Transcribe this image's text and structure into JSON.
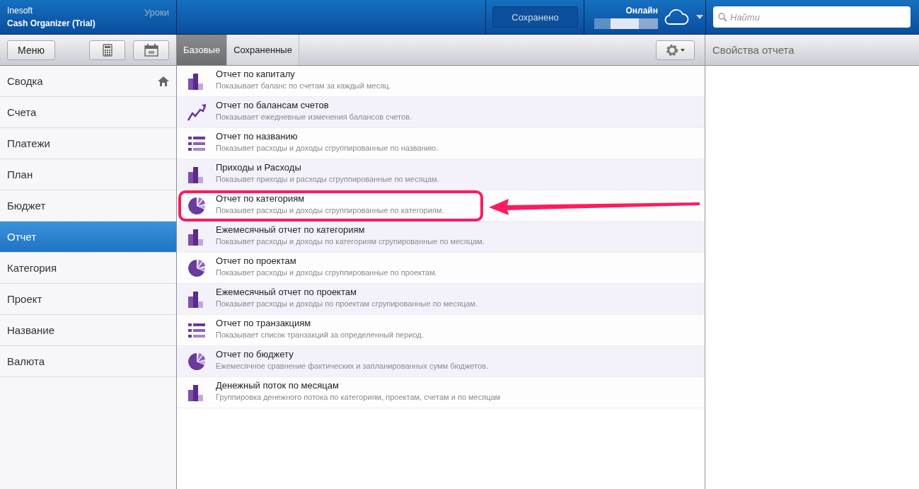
{
  "app": {
    "vendor": "Inesoft",
    "title": "Cash Organizer (Trial)",
    "lessons_link": "Уроки"
  },
  "header": {
    "save_status": "Сохранено",
    "online_label": "Онлайн",
    "sync": {
      "level": 0.7
    },
    "search": {
      "placeholder": "Найти"
    }
  },
  "toolbar": {
    "menu_button": "Меню",
    "tabs": [
      {
        "label": "Базовые",
        "selected": true
      },
      {
        "label": "Сохраненные",
        "selected": false
      }
    ],
    "properties_title": "Свойства отчета"
  },
  "sidebar": {
    "items": [
      {
        "label": "Сводка",
        "selected": false,
        "home": true
      },
      {
        "label": "Счета",
        "selected": false,
        "home": false
      },
      {
        "label": "Платежи",
        "selected": false,
        "home": false
      },
      {
        "label": "План",
        "selected": false,
        "home": false
      },
      {
        "label": "Бюджет",
        "selected": false,
        "home": false
      },
      {
        "label": "Отчет",
        "selected": true,
        "home": false
      },
      {
        "label": "Категория",
        "selected": false,
        "home": false
      },
      {
        "label": "Проект",
        "selected": false,
        "home": false
      },
      {
        "label": "Название",
        "selected": false,
        "home": false
      },
      {
        "label": "Валюта",
        "selected": false,
        "home": false
      }
    ]
  },
  "reports": [
    {
      "kind": "bar",
      "title": "Отчет по капиталу",
      "description": "Показывает баланс по счетам за каждый месяц.",
      "highlighted": false
    },
    {
      "kind": "trend",
      "title": "Отчет по балансам счетов",
      "description": "Показывает ежедневные изменения балансов счетов.",
      "highlighted": false
    },
    {
      "kind": "list",
      "title": "Отчет по названию",
      "description": "Показывет расходы и доходы сгруппированные по названию.",
      "highlighted": false
    },
    {
      "kind": "bar",
      "title": "Приходы и Расходы",
      "description": "Показывет приходы и расходы сгруппированные по месяцам.",
      "highlighted": false
    },
    {
      "kind": "pie",
      "title": "Отчет по категориям",
      "description": "Показывет расходы и доходы сгруппированные по категориям.",
      "highlighted": true
    },
    {
      "kind": "bar",
      "title": "Ежемесячный отчет по категориям",
      "description": "Показывет расходы и доходы по категориям сгрупированные по месяцам.",
      "highlighted": false
    },
    {
      "kind": "pie",
      "title": "Отчет по проектам",
      "description": "Показывет расходы и доходы сгруппированные по проектам.",
      "highlighted": false
    },
    {
      "kind": "bar",
      "title": "Ежемесячный отчет по проектам",
      "description": "Показывет расходы и доходы по проектам сгрупированные по месяцам.",
      "highlighted": false
    },
    {
      "kind": "list",
      "title": "Отчет по транзакциям",
      "description": "Показывает список транзакций за определенный период.",
      "highlighted": false
    },
    {
      "kind": "pie",
      "title": "Отчет по бюджету",
      "description": "Ежемесячное сравнение фактических и запланированных сумм бюджетов.",
      "highlighted": false
    },
    {
      "kind": "bar",
      "title": "Денежный поток по месяцам",
      "description": "Группировка денежного потока по категориям, проектам, счетам и по месяцам",
      "highlighted": false
    }
  ]
}
